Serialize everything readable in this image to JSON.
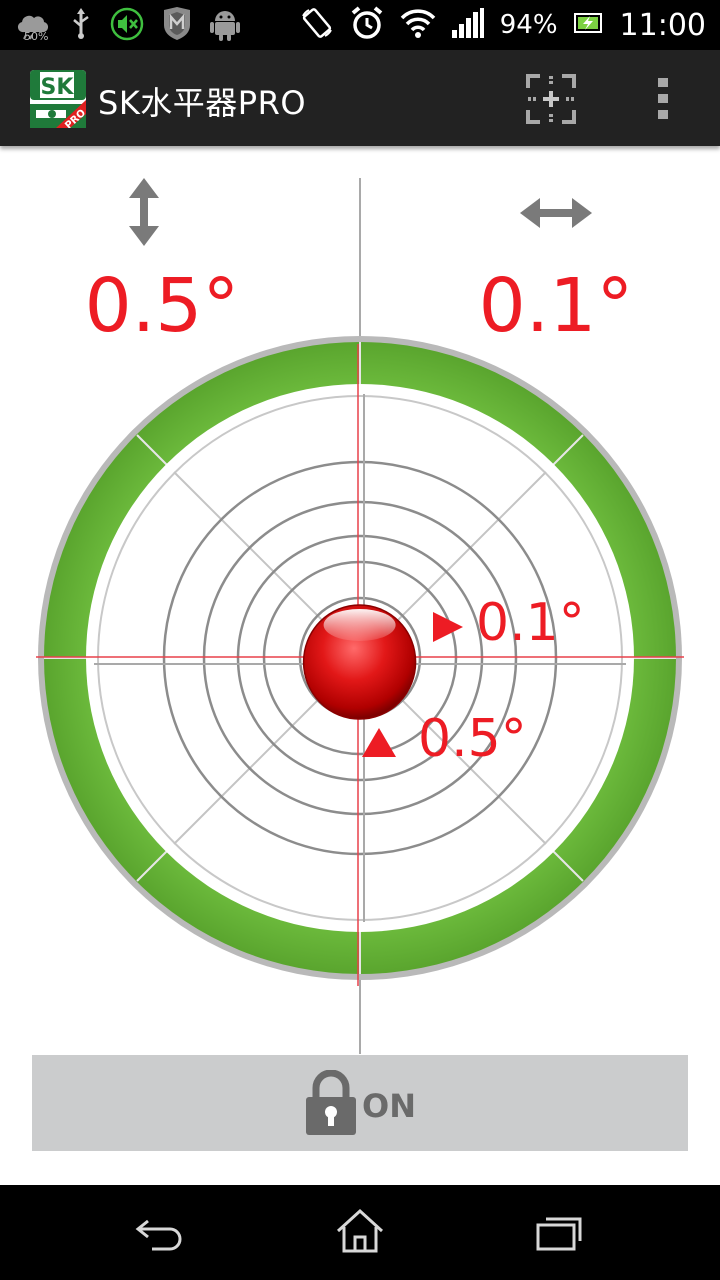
{
  "status_bar": {
    "weather_badge": "50%",
    "battery_percent": "94%",
    "clock": "11:00",
    "icons": [
      "weather-icon",
      "usb-icon",
      "muted-icon",
      "mcafee-icon",
      "android-icon",
      "screen-rotate-icon",
      "alarm-icon",
      "wifi-icon",
      "signal-icon",
      "battery-charging-icon"
    ]
  },
  "action_bar": {
    "app_title": "SK水平器PRO",
    "app_icon_text": "SK",
    "app_icon_badge": "PRO",
    "actions": [
      "calibrate-icon",
      "overflow-menu-icon"
    ]
  },
  "level": {
    "vertical_arrow_icon": "vertical-arrow-icon",
    "horizontal_arrow_icon": "horizontal-arrow-icon",
    "vertical_angle": "0.5°",
    "horizontal_angle": "0.1°",
    "bubble_horizontal_label": "0.1°",
    "bubble_vertical_label": "0.5°",
    "horizontal_tilt_deg": 0.1,
    "vertical_tilt_deg": 0.5
  },
  "lock_toggle": {
    "label": "ON",
    "icon": "lock-icon"
  },
  "nav_bar": {
    "buttons": [
      "back-icon",
      "home-icon",
      "recent-apps-icon"
    ]
  },
  "colors": {
    "accent_red": "#ed1c24",
    "ring_green": "#6cba3c",
    "ring_gray": "#b9b9b9",
    "action_bar": "#222222"
  }
}
